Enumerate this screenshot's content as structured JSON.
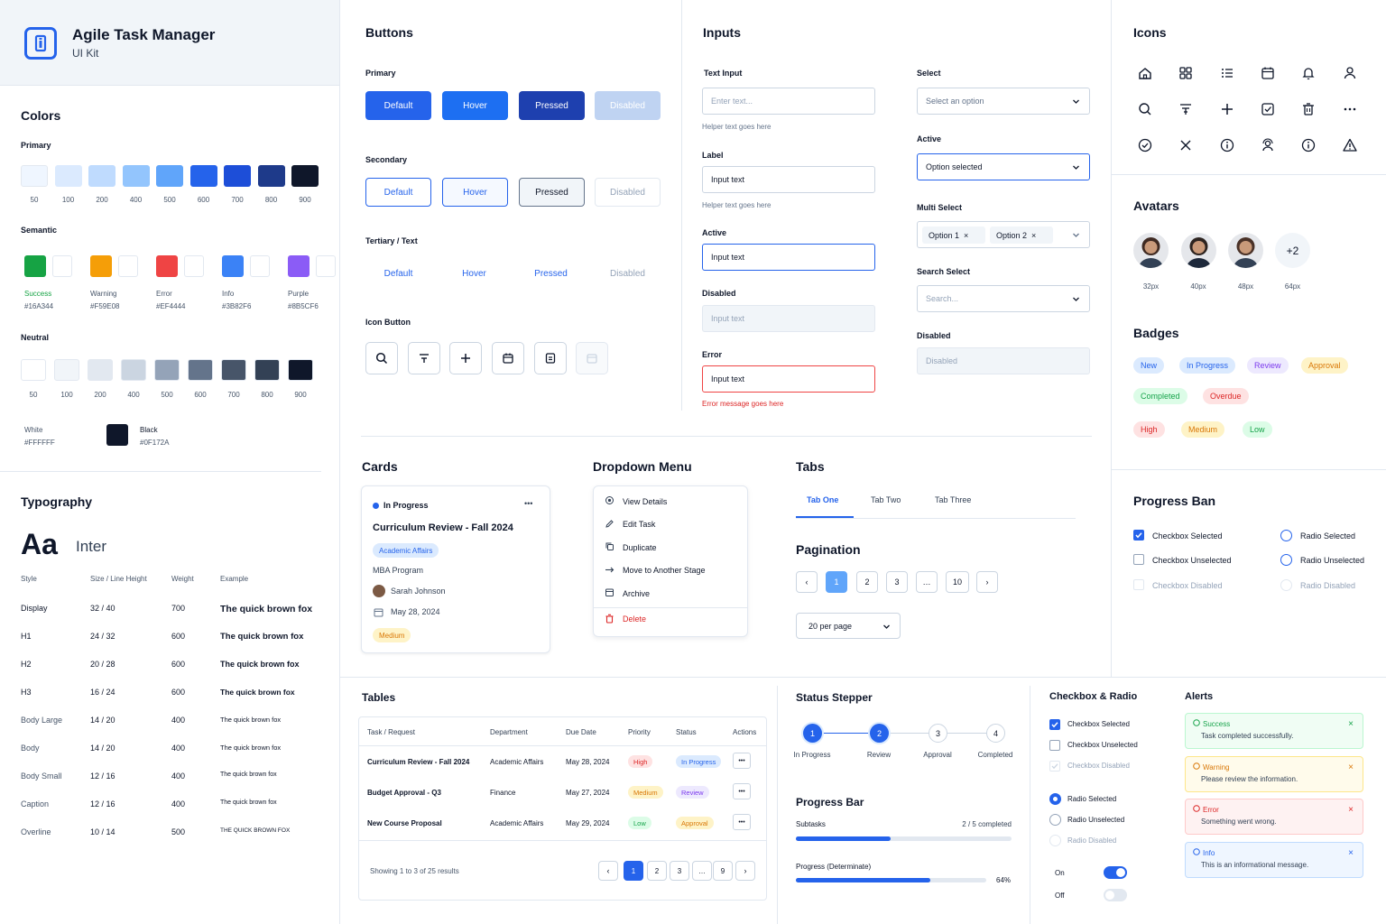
{
  "brand": {
    "title": "Agile Task Manager",
    "subtitle": "UI Kit"
  },
  "colors": {
    "heading": "Colors",
    "primary_label": "Primary",
    "primary": [
      {
        "n": "50",
        "c": "#EFF6FF"
      },
      {
        "n": "100",
        "c": "#DBEAFE"
      },
      {
        "n": "200",
        "c": "#BFDBFE"
      },
      {
        "n": "400",
        "c": "#93C5FD"
      },
      {
        "n": "500",
        "c": "#60A5FA"
      },
      {
        "n": "600",
        "c": "#2563EB"
      },
      {
        "n": "700",
        "c": "#1D4ED8"
      },
      {
        "n": "800",
        "c": "#1E3A8A"
      },
      {
        "n": "900",
        "c": "#0F172A"
      }
    ],
    "semantic_label": "Semantic",
    "semantic": [
      {
        "name": "Success",
        "hex": "#16A344",
        "c": "#16A344",
        "tc": "#16A344"
      },
      {
        "name": "Warning",
        "hex": "#F59E08",
        "c": "#F59E08",
        "tc": "#475569"
      },
      {
        "name": "Error",
        "hex": "#EF4444",
        "c": "#EF4444",
        "tc": "#475569"
      },
      {
        "name": "Info",
        "hex": "#3B82F6",
        "c": "#3B82F6",
        "tc": "#475569"
      },
      {
        "name": "Purple",
        "hex": "#8B5CF6",
        "c": "#8B5CF6",
        "tc": "#475569"
      }
    ],
    "neutral_label": "Neutral",
    "neutral": [
      {
        "n": "50",
        "c": "#FFFFFF"
      },
      {
        "n": "100",
        "c": "#F1F5F9"
      },
      {
        "n": "200",
        "c": "#E2E8F0"
      },
      {
        "n": "400",
        "c": "#CBD5E1"
      },
      {
        "n": "500",
        "c": "#94A3B8"
      },
      {
        "n": "600",
        "c": "#64748B"
      },
      {
        "n": "700",
        "c": "#475569"
      },
      {
        "n": "800",
        "c": "#334155"
      },
      {
        "n": "900",
        "c": "#0F172A"
      }
    ],
    "white_label": "White",
    "white_hex": "#FFFFFF",
    "black_label": "Black",
    "black_hex": "#0F172A"
  },
  "typography": {
    "heading": "Typography",
    "aa": "Aa",
    "font": "Inter",
    "headers": [
      "Style",
      "Size / Line Height",
      "Weight",
      "Example"
    ],
    "rows": [
      {
        "style": "Display",
        "size": "32 / 40",
        "weight": "700",
        "ex": "The quick brown fox"
      },
      {
        "style": "H1",
        "size": "24 / 32",
        "weight": "600",
        "ex": "The quick brown fox"
      },
      {
        "style": "H2",
        "size": "20 / 28",
        "weight": "600",
        "ex": "The quick brown fox"
      },
      {
        "style": "H3",
        "size": "16 / 24",
        "weight": "600",
        "ex": "The quick brown fox"
      },
      {
        "style": "Body Large",
        "size": "14 / 20",
        "weight": "400",
        "ex": "The quick brown fox"
      },
      {
        "style": "Body",
        "size": "14 / 20",
        "weight": "400",
        "ex": "The quick brown fox"
      },
      {
        "style": "Body Small",
        "size": "12 / 16",
        "weight": "400",
        "ex": "The quick brown fox"
      },
      {
        "style": "Caption",
        "size": "12 / 16",
        "weight": "400",
        "ex": "The quick brown fox"
      },
      {
        "style": "Overline",
        "size": "10 / 14",
        "weight": "500",
        "ex": "THE QUICK BROWN FOX"
      }
    ]
  },
  "buttons": {
    "heading": "Buttons",
    "primary_label": "Primary",
    "secondary_label": "Secondary",
    "tertiary_label": "Tertiary / Text",
    "icon_label": "Icon Button",
    "states": [
      "Default",
      "Hover",
      "Pressed",
      "Disabled"
    ]
  },
  "inputs": {
    "heading": "Inputs",
    "text_input_label": "Text Input",
    "placeholder": "Enter text...",
    "helper": "Helper text goes here",
    "label_label": "Label",
    "label_value": "Input text",
    "helper2": "Helper text goes here",
    "active_label": "Active",
    "active_value": "Input text",
    "disabled_label": "Disabled",
    "disabled_value": "Input text",
    "error_label": "Error",
    "error_value": "Input text",
    "error_msg": "Error message goes here",
    "select_label": "Select",
    "select_placeholder": "Select an option",
    "select_active_label": "Active",
    "select_active_value": "Option selected",
    "multi_label": "Multi Select",
    "multi_chips": [
      "Option 1",
      "Option 2"
    ],
    "search_label": "Search Select",
    "search_placeholder": "Search...",
    "sel_disabled_label": "Disabled",
    "sel_disabled_value": "Disabled"
  },
  "icons": {
    "heading": "Icons",
    "list": [
      "home-icon",
      "grid-icon",
      "list-icon",
      "calendar-icon",
      "bell-icon",
      "user-icon",
      "search-icon",
      "filter-icon",
      "plus-icon",
      "checkbox-icon",
      "trash-icon",
      "more-icon",
      "check-circle-icon",
      "close-icon",
      "info-icon",
      "user-card-icon",
      "info-circle-icon",
      "warning-icon"
    ]
  },
  "avatars": {
    "heading": "Avatars",
    "sizes": [
      "32px",
      "40px",
      "48px",
      "64px"
    ],
    "more": "+2"
  },
  "badges": {
    "heading": "Badges",
    "items": [
      {
        "t": "New",
        "bg": "#DBEAFE",
        "c": "#2563EB"
      },
      {
        "t": "In Progress",
        "bg": "#DBEAFE",
        "c": "#2563EB"
      },
      {
        "t": "Review",
        "bg": "#EDE9FE",
        "c": "#7C3AED"
      },
      {
        "t": "Approval",
        "bg": "#FEF3C7",
        "c": "#D97706"
      },
      {
        "t": "Completed",
        "bg": "#DCFCE7",
        "c": "#16A34A"
      },
      {
        "t": "Overdue",
        "bg": "#FEE2E2",
        "c": "#DC2626"
      },
      {
        "t": "High",
        "bg": "#FEE2E2",
        "c": "#DC2626"
      },
      {
        "t": "Medium",
        "bg": "#FEF3C7",
        "c": "#D97706"
      },
      {
        "t": "Low",
        "bg": "#DCFCE7",
        "c": "#16A34A"
      }
    ]
  },
  "progress_ban": {
    "heading": "Progress Ban",
    "cb_selected": "Checkbox Selected",
    "cb_unselected": "Checkbox Unselected",
    "cb_disabled": "Checkbox Disabled",
    "rd_selected": "Radio Selected",
    "rd_unselected": "Radio Unselected",
    "rd_disabled": "Radio Disabled"
  },
  "cards": {
    "heading": "Cards",
    "status": "In Progress",
    "title": "Curriculum Review - Fall 2024",
    "tag": "Academic Affairs",
    "program": "MBA Program",
    "person": "Sarah Johnson",
    "date": "May 28, 2024",
    "priority": "Medium",
    "more": "•••"
  },
  "dropdown": {
    "heading": "Dropdown Menu",
    "items": [
      {
        "t": "View Details",
        "i": "eye-icon"
      },
      {
        "t": "Edit Task",
        "i": "edit-icon"
      },
      {
        "t": "Duplicate",
        "i": "copy-icon"
      },
      {
        "t": "Move to Another Stage",
        "i": "arrow-right-icon"
      },
      {
        "t": "Archive",
        "i": "archive-icon"
      }
    ],
    "delete": "Delete"
  },
  "tabs": {
    "heading": "Tabs",
    "items": [
      "Tab One",
      "Tab Two",
      "Tab Three"
    ]
  },
  "pagination": {
    "heading": "Pagination",
    "pages": [
      "1",
      "2",
      "3",
      "…",
      "10"
    ],
    "per_page": "20 per page"
  },
  "tables": {
    "heading": "Tables",
    "headers": [
      "Task / Request",
      "Department",
      "Due Date",
      "Priority",
      "Status",
      "Actions"
    ],
    "rows": [
      {
        "task": "Curriculum Review - Fall 2024",
        "dept": "Academic Affairs",
        "due": "May 28, 2024",
        "priority": "High",
        "pbg": "#FEE2E2",
        "pc": "#DC2626",
        "status": "In Progress",
        "sbg": "#DBEAFE",
        "sc": "#2563EB"
      },
      {
        "task": "Budget Approval - Q3",
        "dept": "Finance",
        "due": "May 27, 2024",
        "priority": "Medium",
        "pbg": "#FEF3C7",
        "pc": "#D97706",
        "status": "Review",
        "sbg": "#EDE9FE",
        "sc": "#7C3AED"
      },
      {
        "task": "New Course Proposal",
        "dept": "Academic Affairs",
        "due": "May 29, 2024",
        "priority": "Low",
        "pbg": "#DCFCE7",
        "pc": "#16A34A",
        "status": "Approval",
        "sbg": "#FEF3C7",
        "sc": "#D97706"
      }
    ],
    "footer": "Showing 1 to 3 of 25 results",
    "pages": [
      "1",
      "2",
      "3",
      "…",
      "9"
    ],
    "more": "•••"
  },
  "stepper": {
    "heading": "Status Stepper",
    "steps": [
      {
        "n": "1",
        "t": "In Progress",
        "done": true
      },
      {
        "n": "2",
        "t": "Review",
        "done": true
      },
      {
        "n": "3",
        "t": "Approval",
        "done": false
      },
      {
        "n": "4",
        "t": "Completed",
        "done": false
      }
    ]
  },
  "progress": {
    "heading": "Progress Bar",
    "subtasks": "Subtasks",
    "subtasks_value": "2 / 5 completed",
    "subtasks_fraction": 0.4,
    "det_label": "Progress (Determinate)",
    "det_value": "64%",
    "det_fraction": 0.64
  },
  "checkradio": {
    "heading": "Checkbox & Radio",
    "cb_selected": "Checkbox Selected",
    "cb_unselected": "Checkbox Unselected",
    "cb_disabled": "Checkbox Disabled",
    "rd_selected": "Radio Selected",
    "rd_unselected": "Radio Unselected",
    "rd_disabled": "Radio Disabled",
    "on": "On",
    "off": "Off"
  },
  "alerts": {
    "heading": "Alerts",
    "items": [
      {
        "t": "Success",
        "m": "Task completed successfully.",
        "bg": "#F0FDF4",
        "bd": "#BBF7D0",
        "c": "#16A34A"
      },
      {
        "t": "Warning",
        "m": "Please review the information.",
        "bg": "#FFFBEB",
        "bd": "#FDE68A",
        "c": "#D97706"
      },
      {
        "t": "Error",
        "m": "Something went wrong.",
        "bg": "#FEF2F2",
        "bd": "#FECACA",
        "c": "#DC2626"
      },
      {
        "t": "Info",
        "m": "This is an informational message.",
        "bg": "#EFF6FF",
        "bd": "#BFDBFE",
        "c": "#2563EB"
      }
    ]
  },
  "accent": "#2563EB"
}
